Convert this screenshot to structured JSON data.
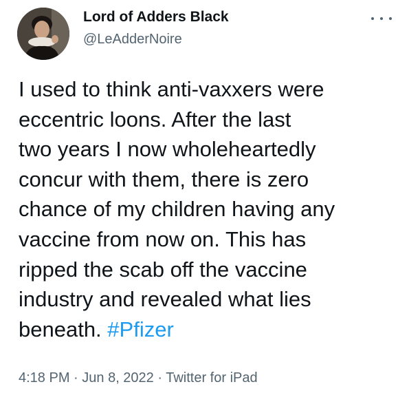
{
  "author": {
    "display_name": "Lord of Adders Black",
    "handle": "@LeAdderNoire",
    "avatar_icon": "profile-photo"
  },
  "more_icon": "more-options-icon",
  "tweet": {
    "lines": [
      "I used to think anti-vaxxers were",
      "eccentric loons. After the last",
      "two years I now wholeheartedly",
      "concur with them, there is zero",
      "chance of my children having any",
      "vaccine from now on. This has",
      "ripped the scab off the vaccine",
      "industry and revealed what lies"
    ],
    "last_line_text": "beneath. ",
    "hashtag": "#Pfizer"
  },
  "meta": {
    "time": "4:18 PM",
    "separator": " · ",
    "date": "Jun 8, 2022",
    "source": "Twitter for iPad"
  },
  "colors": {
    "text": "#0f1419",
    "secondary": "#536471",
    "link": "#1d9bf0"
  }
}
